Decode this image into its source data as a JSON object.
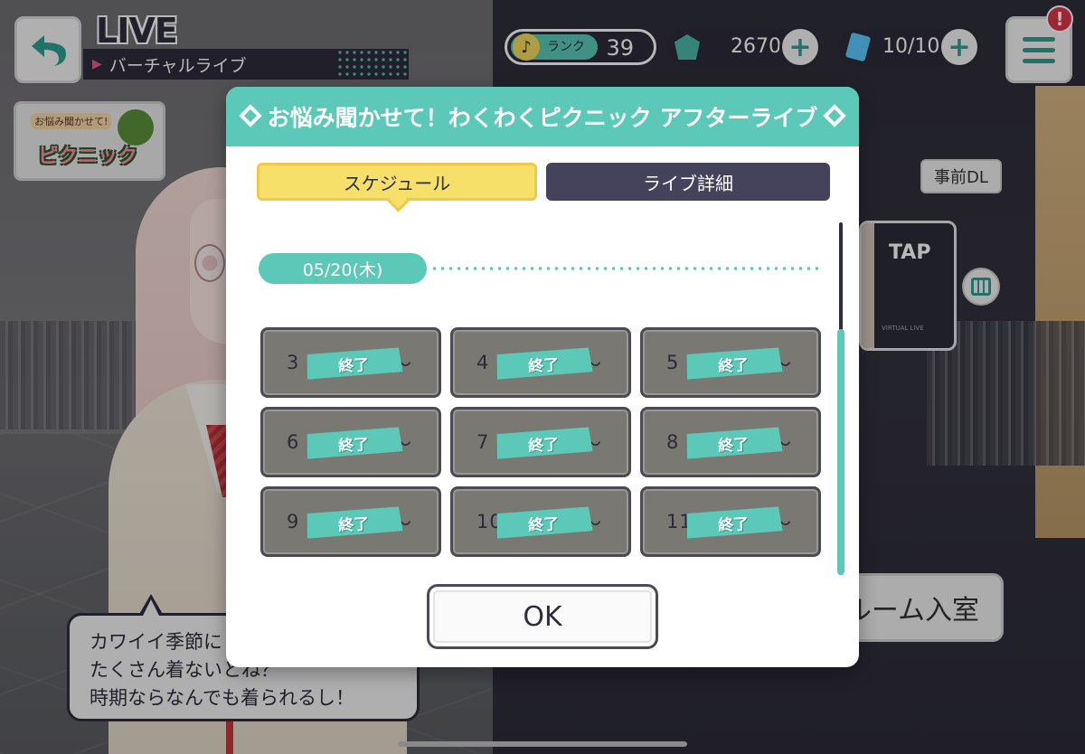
{
  "header": {
    "title": "LIVE",
    "breadcrumb": "バーチャルライブ"
  },
  "resources": {
    "rank_label": "ランク",
    "rank_value": "39",
    "gems": "2670",
    "tickets": "10/10"
  },
  "menu_badge": "!",
  "event_banner": {
    "top_text": "お悩み聞かせて!",
    "main_text": "ピクニック"
  },
  "predl_label": "事前DL",
  "tap_card": {
    "label": "TAP",
    "subtext": "VIRTUAL LIVE"
  },
  "room_button_label": "ルーム入室",
  "speech": {
    "lines": [
      "カワイイ季節に",
      "たくさん着ないとね？",
      "時期ならなんでも着られるし！"
    ]
  },
  "modal": {
    "title": "お悩み聞かせて！わくわくピクニック アフターライブ",
    "tabs": [
      "スケジュール",
      "ライブ詳細"
    ],
    "active_tab": 0,
    "date": "05/20(木)",
    "slots": [
      {
        "time": "3",
        "status": "終了",
        "tilde": "〜"
      },
      {
        "time": "4",
        "status": "終了",
        "tilde": "〜"
      },
      {
        "time": "5",
        "status": "終了",
        "tilde": "〜"
      },
      {
        "time": "6",
        "status": "終了",
        "tilde": "〜"
      },
      {
        "time": "7",
        "status": "終了",
        "tilde": "〜"
      },
      {
        "time": "8",
        "status": "終了",
        "tilde": "〜"
      },
      {
        "time": "9",
        "status": "終了",
        "tilde": "〜"
      },
      {
        "time": "10",
        "status": "終了",
        "tilde": "〜"
      },
      {
        "time": "11",
        "status": "終了",
        "tilde": "〜"
      }
    ],
    "ok_label": "OK"
  },
  "colors": {
    "accent": "#5bc8b8",
    "tab_active": "#f7e06a",
    "tab_inactive": "#45435b",
    "dark": "#2e2d3b",
    "slot_ended": "#7a7872",
    "badge": "#d8344c"
  },
  "icons": [
    "back-arrow-icon",
    "note-icon",
    "gem-icon",
    "ticket-icon",
    "plus-icon",
    "menu-icon",
    "calendar-icon",
    "diamond-icon"
  ]
}
